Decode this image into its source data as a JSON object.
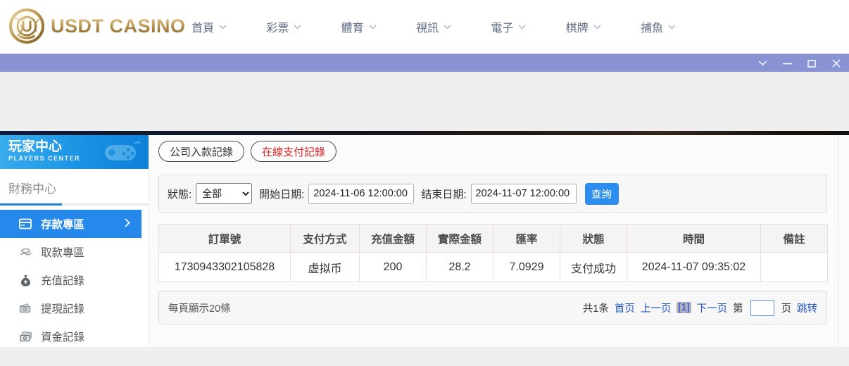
{
  "brand": {
    "name": "USDT CASINO",
    "monogram": "U"
  },
  "nav": {
    "items": [
      {
        "label": "首頁"
      },
      {
        "label": "彩票"
      },
      {
        "label": "體育"
      },
      {
        "label": "視訊"
      },
      {
        "label": "電子"
      },
      {
        "label": "棋牌"
      },
      {
        "label": "捕魚"
      }
    ]
  },
  "sidebar": {
    "title": "玩家中心",
    "subtitle": "PLAYERS CENTER",
    "section_title": "財務中心",
    "items": [
      {
        "label": "存款專區",
        "active": true
      },
      {
        "label": "取款專區",
        "active": false
      },
      {
        "label": "充值記錄",
        "active": false
      },
      {
        "label": "提現記錄",
        "active": false
      },
      {
        "label": "資金記錄",
        "active": false
      }
    ]
  },
  "main": {
    "tabs": [
      {
        "label": "公司入款記錄",
        "active": false
      },
      {
        "label": "在線支付記錄",
        "active": true
      }
    ],
    "filters": {
      "status_label": "狀態:",
      "status_value": "全部",
      "start_label": "開始日期:",
      "start_value": "2024-11-06 12:00:00",
      "end_label": "结束日期:",
      "end_value": "2024-11-07 12:00:00",
      "search_button": "查詢"
    },
    "table": {
      "headers": [
        "訂單號",
        "支付方式",
        "充值金額",
        "實際金額",
        "匯率",
        "狀態",
        "時間",
        "備註"
      ],
      "rows": [
        {
          "order_no": "1730943302105828",
          "pay_method": "虚拟币",
          "amount": "200",
          "actual": "28.2",
          "rate": "7.0929",
          "status": "支付成功",
          "time": "2024-11-07 09:35:02",
          "remark": ""
        }
      ]
    },
    "pagination": {
      "page_size_text": "每頁顯示20條",
      "total_text": "共1条",
      "first_label": "首页",
      "prev_label": "上一页",
      "current_page": "[1]",
      "next_label": "下一页",
      "jump_prefix": "第",
      "jump_suffix": "页",
      "jump_label": "跳转",
      "jump_value": ""
    }
  },
  "colors": {
    "titlebar_purple": "#8992d3",
    "sidebar_active_blue": "#2688ea",
    "sidebar_header_gradient_start": "#3aadee",
    "sidebar_header_gradient_end": "#0e7fd8",
    "accent_button_blue": "#2b8ded",
    "tab_active_red": "#e02222",
    "link_blue": "#2157c9",
    "brand_gold": "#b08c46",
    "table_border_pink": "#f0d9d9"
  }
}
